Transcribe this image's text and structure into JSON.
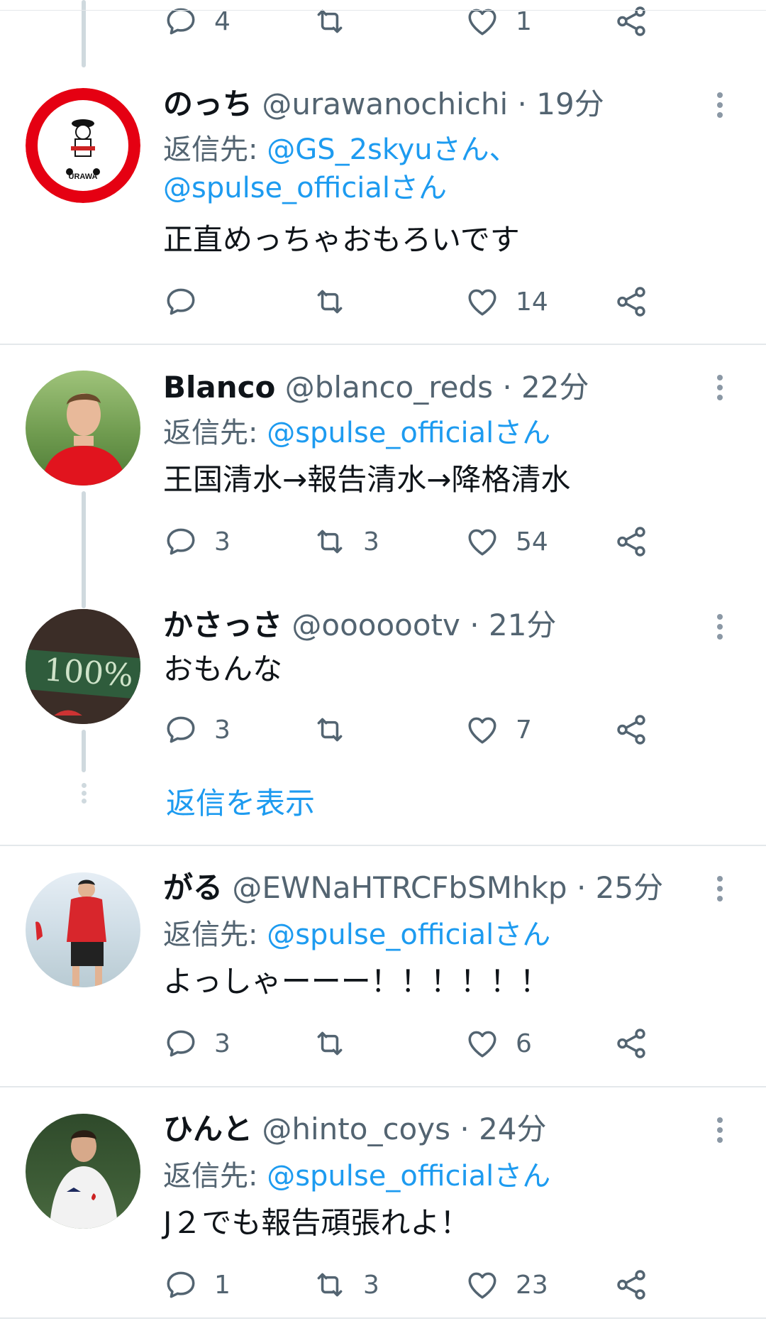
{
  "top": {
    "reply_count": "4",
    "retweet_count": "",
    "like_count": "1"
  },
  "tweets": [
    {
      "name": "のっち",
      "handle": "@urawanochichi",
      "dot": "·",
      "time": "19分",
      "reply_prefix": "返信先: ",
      "mentions_line1": "@GS_2skyuさん、",
      "mentions_line2": "@spulse_officialさん",
      "text": "正直めっちゃおもろいです",
      "reply_count": "",
      "retweet_count": "",
      "like_count": "14",
      "avatar_text_top": "ESTD",
      "avatar_text_year": "2018",
      "avatar_text_name": "URAWA"
    },
    {
      "name": "Blanco",
      "handle": "@blanco_reds",
      "dot": "·",
      "time": "22分",
      "reply_prefix": "返信先: ",
      "mention": "@spulse_officialさん",
      "text": "王国清水→報告清水→降格清水",
      "reply_count": "3",
      "retweet_count": "3",
      "like_count": "54"
    },
    {
      "name": "かさっさ",
      "handle": "@ooooootv",
      "dot": "·",
      "time": "21分",
      "text": "おもんな",
      "reply_count": "3",
      "retweet_count": "",
      "like_count": "7",
      "avatar_text": "100%"
    },
    {
      "name": "がる",
      "handle": "@EWNaHTRCFbSMhkp",
      "dot": "·",
      "time": "25分",
      "reply_prefix": "返信先: ",
      "mention": "@spulse_officialさん",
      "text": "よっしゃーーー！！！！！！",
      "reply_count": "3",
      "retweet_count": "",
      "like_count": "6"
    },
    {
      "name": "ひんと",
      "handle": "@hinto_coys",
      "dot": "·",
      "time": "24分",
      "reply_prefix": "返信先: ",
      "mention": "@spulse_officialさん",
      "text": "J２でも報告頑張れよ！",
      "reply_count": "1",
      "retweet_count": "3",
      "like_count": "23"
    }
  ],
  "show_replies": "返信を表示",
  "icons": {
    "reply": "reply-icon",
    "retweet": "retweet-icon",
    "like": "heart-icon",
    "share": "share-icon",
    "more": "more-vertical-icon"
  },
  "colors": {
    "link": "#1d9bf0",
    "secondary": "#536471",
    "text": "#0f1419",
    "thread_line": "#cfd9de"
  }
}
